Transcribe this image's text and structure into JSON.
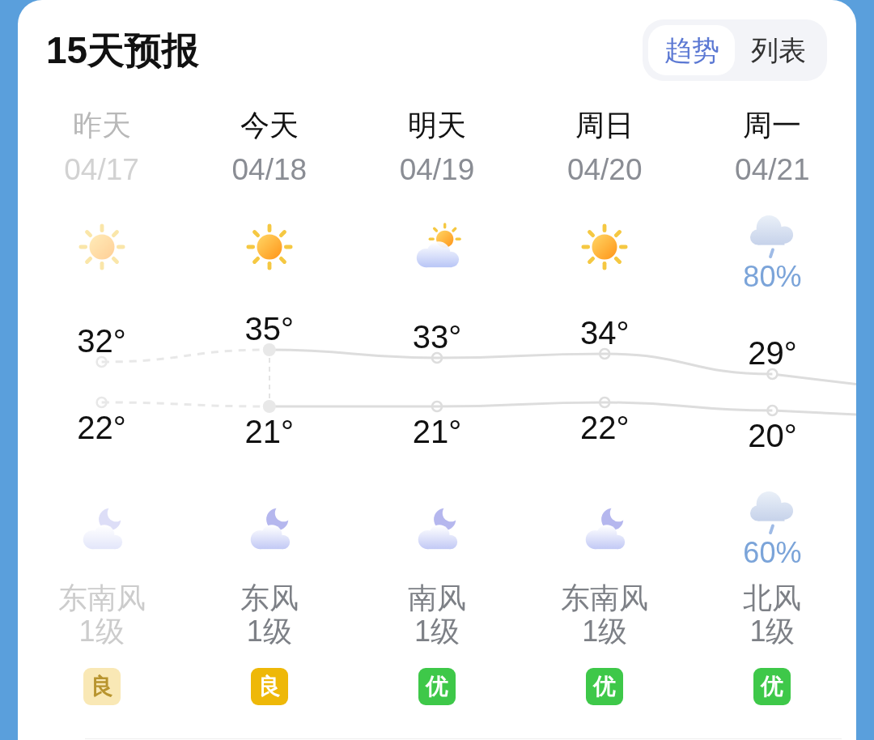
{
  "header": {
    "title": "15天预报",
    "view_tabs": [
      {
        "label": "趋势",
        "selected": true
      },
      {
        "label": "列表",
        "selected": false
      }
    ]
  },
  "days": [
    {
      "name": "昨天",
      "date": "04/17",
      "past": true,
      "current": false,
      "day_weather": {
        "kind": "sunny"
      },
      "night_weather": {
        "kind": "cloudy_night"
      },
      "wind": "东南风",
      "wind_level": "1级",
      "aqi": {
        "label": "良",
        "color": "#f9e8b5"
      }
    },
    {
      "name": "今天",
      "date": "04/18",
      "past": false,
      "current": true,
      "day_weather": {
        "kind": "sunny"
      },
      "night_weather": {
        "kind": "cloudy_night"
      },
      "wind": "东风",
      "wind_level": "1级",
      "aqi": {
        "label": "良",
        "color": "#eeb808"
      }
    },
    {
      "name": "明天",
      "date": "04/19",
      "past": false,
      "current": false,
      "day_weather": {
        "kind": "partly_cloudy"
      },
      "night_weather": {
        "kind": "cloudy_night"
      },
      "wind": "南风",
      "wind_level": "1级",
      "aqi": {
        "label": "优",
        "color": "#3ec849"
      }
    },
    {
      "name": "周日",
      "date": "04/20",
      "past": false,
      "current": false,
      "day_weather": {
        "kind": "sunny"
      },
      "night_weather": {
        "kind": "cloudy_night"
      },
      "wind": "东南风",
      "wind_level": "1级",
      "aqi": {
        "label": "优",
        "color": "#3ec849"
      }
    },
    {
      "name": "周一",
      "date": "04/21",
      "past": false,
      "current": false,
      "day_weather": {
        "kind": "rain",
        "precipitation": "80%"
      },
      "night_weather": {
        "kind": "rain",
        "precipitation": "60%"
      },
      "wind": "北风",
      "wind_level": "1级",
      "aqi": {
        "label": "优",
        "color": "#3ec849"
      }
    }
  ],
  "temperature_chart": {
    "chart_data": {
      "type": "line",
      "data_labels": true,
      "series": [
        {
          "color": "#e8e8e8",
          "line_style": "dashed",
          "marker": "circle",
          "values": [
            32,
            35,
            null,
            null,
            null
          ],
          "value_labels": [
            "32°",
            null,
            null,
            null,
            null
          ]
        },
        {
          "color": "#dddddd",
          "line_style": "solid",
          "marker": "circle",
          "values": [
            null,
            35,
            33,
            34,
            29
          ],
          "value_labels": [
            null,
            "35°",
            "33°",
            "34°",
            "29°"
          ]
        },
        {
          "color": "#e8e8e8",
          "line_style": "dashed",
          "marker": "circle",
          "values": [
            22,
            21,
            null,
            null,
            null
          ],
          "value_labels": [
            "22°",
            null,
            null,
            null,
            null
          ]
        },
        {
          "color": "#dddddd",
          "line_style": "solid",
          "marker": "circle",
          "values": [
            null,
            21,
            21,
            22,
            20
          ],
          "value_labels": [
            null,
            "21°",
            "21°",
            "22°",
            "20°"
          ]
        }
      ]
    }
  }
}
